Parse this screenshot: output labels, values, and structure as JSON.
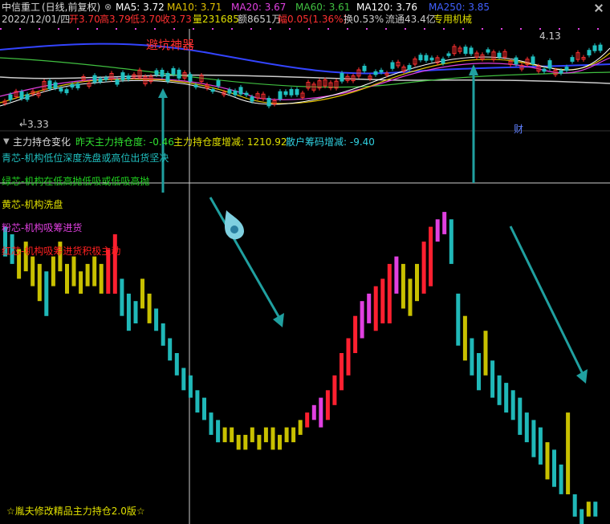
{
  "header": {
    "stock_name": "中信重工",
    "period": "(日线,前复权)",
    "ma": [
      {
        "label": "MA5:",
        "value": "3.72",
        "color": "#ffffff"
      },
      {
        "label": "MA10:",
        "value": "3.71",
        "color": "#e0c000"
      },
      {
        "label": "MA20:",
        "value": "3.67",
        "color": "#e040e0"
      },
      {
        "label": "MA60:",
        "value": "3.61",
        "color": "#40c040"
      },
      {
        "label": "MA120:",
        "value": "3.76",
        "color": "#ffffff"
      },
      {
        "label": "MA250:",
        "value": "3.85",
        "color": "#4060ff"
      }
    ]
  },
  "quote": {
    "date": "2022/12/01/四",
    "open_label": "开",
    "open": "3.70",
    "high_label": "高",
    "high": "3.79",
    "low_label": "低",
    "low": "3.70",
    "close_label": "收",
    "close": "3.73",
    "volume_label": "量",
    "volume": "231685",
    "amount_label": "额",
    "amount": "8651万",
    "change_label": "幅",
    "change": "0.05(1.36%)",
    "turnover_label": "换",
    "turnover": "0.53%",
    "float_label": "流通",
    "float_value": "43.4亿",
    "sector": "专用机械"
  },
  "price_panel": {
    "annotation": "避坑神器",
    "high_marker": "4.13",
    "low_marker": "3.33",
    "finance_marker": "财"
  },
  "indicator": {
    "name": "主力持仓变化",
    "items": [
      {
        "label": "昨天主力持仓度:",
        "value": "-0.46"
      },
      {
        "label": "主力持仓度增减:",
        "value": "1210.92"
      },
      {
        "label": "散户筹码增减:",
        "value": "-9.40"
      }
    ],
    "legend": [
      {
        "text": "青芯-机构低位深度洗盘或高位出货坚决",
        "color": "#20c0c0"
      },
      {
        "text": "绿芯-机构在低高抛低吸或低吸高抛",
        "color": "#20d020"
      },
      {
        "text": "黄芯-机构洗盘",
        "color": "#e0e000"
      },
      {
        "text": "粉芯-机构吸筹进货",
        "color": "#e040e0"
      },
      {
        "text": "红芯-机构吸筹进货积极主动",
        "color": "#ff2020"
      }
    ],
    "footer": "☆胤夫修改精品主力持仓2.0版☆"
  },
  "chart_data": {
    "type": "bar",
    "description_series": "主力持仓变化",
    "note": "stepped candle-style indicator; each bar = [open, close, color]",
    "ylim": [
      0,
      100
    ],
    "bars": [
      [
        80,
        72,
        "cy"
      ],
      [
        78,
        70,
        "cy"
      ],
      [
        74,
        66,
        "ye"
      ],
      [
        76,
        68,
        "ye"
      ],
      [
        72,
        64,
        "ye"
      ],
      [
        70,
        60,
        "ye"
      ],
      [
        68,
        56,
        "cy"
      ],
      [
        72,
        64,
        "ye"
      ],
      [
        76,
        68,
        "ye"
      ],
      [
        70,
        62,
        "ye"
      ],
      [
        72,
        64,
        "ye"
      ],
      [
        68,
        62,
        "ye"
      ],
      [
        70,
        64,
        "ye"
      ],
      [
        72,
        64,
        "ye"
      ],
      [
        70,
        62,
        "ye"
      ],
      [
        74,
        62,
        "re"
      ],
      [
        78,
        62,
        "re"
      ],
      [
        66,
        56,
        "cy"
      ],
      [
        62,
        52,
        "cy"
      ],
      [
        60,
        54,
        "cy"
      ],
      [
        66,
        58,
        "ye"
      ],
      [
        62,
        54,
        "ye"
      ],
      [
        58,
        52,
        "cy"
      ],
      [
        54,
        48,
        "cy"
      ],
      [
        50,
        44,
        "cy"
      ],
      [
        46,
        40,
        "cy"
      ],
      [
        42,
        36,
        "cy"
      ],
      [
        40,
        34,
        "cy"
      ],
      [
        36,
        30,
        "cy"
      ],
      [
        34,
        28,
        "cy"
      ],
      [
        30,
        24,
        "cy"
      ],
      [
        28,
        22,
        "cy"
      ],
      [
        26,
        22,
        "ye"
      ],
      [
        26,
        22,
        "ye"
      ],
      [
        24,
        20,
        "ye"
      ],
      [
        24,
        20,
        "ye"
      ],
      [
        26,
        22,
        "ye"
      ],
      [
        24,
        20,
        "ye"
      ],
      [
        26,
        22,
        "ye"
      ],
      [
        26,
        20,
        "ye"
      ],
      [
        24,
        20,
        "ye"
      ],
      [
        26,
        22,
        "ye"
      ],
      [
        26,
        22,
        "ye"
      ],
      [
        28,
        24,
        "ye"
      ],
      [
        30,
        26,
        "re"
      ],
      [
        32,
        28,
        "pk"
      ],
      [
        34,
        26,
        "pk"
      ],
      [
        36,
        28,
        "re"
      ],
      [
        40,
        32,
        "re"
      ],
      [
        46,
        36,
        "re"
      ],
      [
        50,
        40,
        "re"
      ],
      [
        56,
        46,
        "re"
      ],
      [
        60,
        50,
        "pk"
      ],
      [
        62,
        54,
        "pk"
      ],
      [
        64,
        52,
        "re"
      ],
      [
        66,
        54,
        "re"
      ],
      [
        70,
        54,
        "re"
      ],
      [
        72,
        62,
        "pk"
      ],
      [
        70,
        58,
        "ye"
      ],
      [
        66,
        56,
        "ye"
      ],
      [
        70,
        60,
        "ye"
      ],
      [
        76,
        62,
        "re"
      ],
      [
        80,
        64,
        "re"
      ],
      [
        82,
        76,
        "pk"
      ],
      [
        84,
        78,
        "pk"
      ],
      [
        82,
        70,
        "cy"
      ],
      [
        62,
        48,
        "cy"
      ],
      [
        56,
        44,
        "ye"
      ],
      [
        50,
        40,
        "cy"
      ],
      [
        46,
        36,
        "cy"
      ],
      [
        52,
        40,
        "ye"
      ],
      [
        44,
        34,
        "cy"
      ],
      [
        40,
        32,
        "cy"
      ],
      [
        38,
        30,
        "cy"
      ],
      [
        36,
        28,
        "cy"
      ],
      [
        34,
        24,
        "cy"
      ],
      [
        30,
        22,
        "cy"
      ],
      [
        28,
        18,
        "cy"
      ],
      [
        26,
        16,
        "cy"
      ],
      [
        22,
        12,
        "ye"
      ],
      [
        20,
        10,
        "cy"
      ],
      [
        16,
        8,
        "cy"
      ],
      [
        30,
        8,
        "ye"
      ],
      [
        8,
        2,
        "cy"
      ],
      [
        4,
        0,
        "cy"
      ],
      [
        6,
        2,
        "ye"
      ],
      [
        6,
        2,
        "cy"
      ]
    ]
  }
}
